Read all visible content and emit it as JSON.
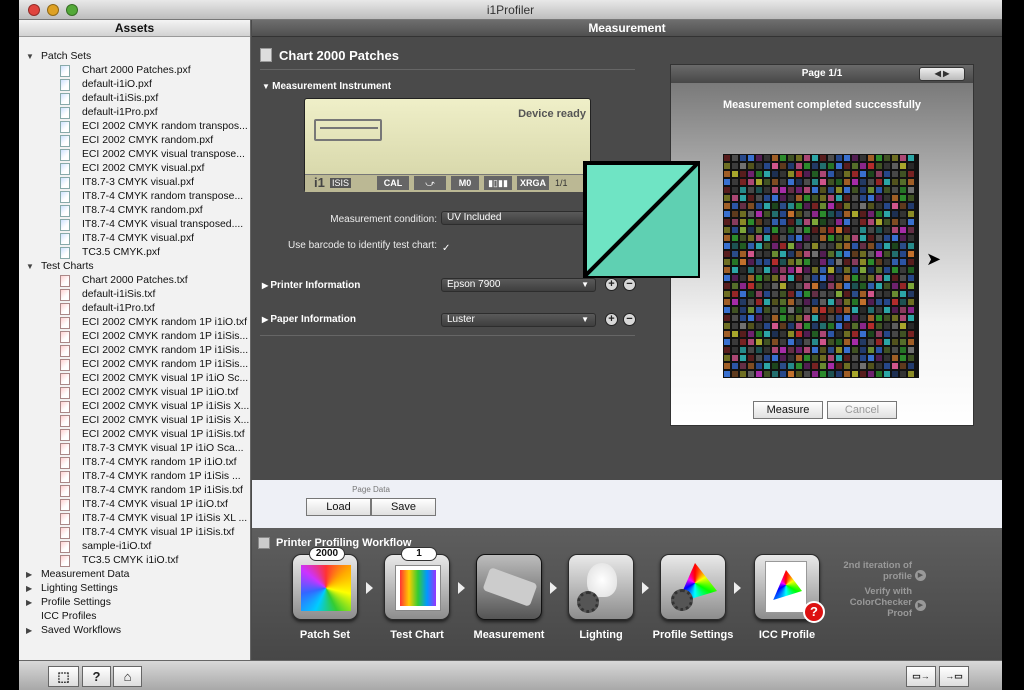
{
  "window": {
    "title": "i1Profiler"
  },
  "sidebar": {
    "title": "Assets",
    "patch_sets": {
      "label": "Patch Sets",
      "items": [
        "Chart 2000 Patches.pxf",
        "default-i1iO.pxf",
        "default-i1iSis.pxf",
        "default-i1Pro.pxf",
        "ECI 2002 CMYK random transpos...",
        "ECI 2002 CMYK random.pxf",
        "ECI 2002 CMYK visual transpose...",
        "ECI 2002 CMYK visual.pxf",
        "IT8.7-3 CMYK visual.pxf",
        "IT8.7-4 CMYK random transpose...",
        "IT8.7-4 CMYK random.pxf",
        "IT8.7-4 CMYK visual transposed....",
        "IT8.7-4 CMYK visual.pxf",
        "TC3.5 CMYK.pxf"
      ]
    },
    "test_charts": {
      "label": "Test Charts",
      "items": [
        "Chart 2000 Patches.txf",
        "default-i1iSis.txf",
        "default-i1Pro.txf",
        "ECI 2002 CMYK random 1P i1iO.txf",
        "ECI 2002 CMYK random 1P i1iSis...",
        "ECI 2002 CMYK random 1P i1iSis...",
        "ECI 2002 CMYK random 1P i1iSis...",
        "ECI 2002 CMYK visual 1P i1iO Sc...",
        "ECI 2002 CMYK visual 1P i1iO.txf",
        "ECI 2002 CMYK visual 1P i1iSis X...",
        "ECI 2002 CMYK visual 1P i1iSis X...",
        "ECI 2002 CMYK visual 1P i1iSis.txf",
        "IT8.7-3 CMYK visual 1P i1iO Sca...",
        "IT8.7-4 CMYK random 1P i1iO.txf",
        "IT8.7-4 CMYK random 1P i1iSis ...",
        "IT8.7-4 CMYK random 1P i1iSis.txf",
        "IT8.7-4 CMYK visual 1P i1iO.txf",
        "IT8.7-4 CMYK visual 1P i1iSis XL ...",
        "IT8.7-4 CMYK visual 1P i1iSis.txf",
        "sample-i1iO.txf",
        "TC3.5 CMYK i1iO.txf"
      ]
    },
    "collapsed": [
      "Measurement Data",
      "Lighting Settings",
      "Profile Settings",
      "ICC Profiles",
      "Saved Workflows"
    ]
  },
  "main": {
    "header": "Measurement",
    "chart_title": "Chart 2000 Patches",
    "instrument_section": "Measurement Instrument",
    "device_status": "Device ready",
    "device_buttons": [
      "CAL",
      "M0",
      "XRGA",
      "1/1"
    ],
    "device_brand": "i1",
    "device_model": "ISIS",
    "measurement_condition_label": "Measurement condition:",
    "measurement_condition_value": "UV Included",
    "barcode_label": "Use barcode to identify test chart:",
    "barcode_checked": "✓",
    "printer_info_label": "Printer Information",
    "printer_value": "Epson 7900",
    "paper_info_label": "Paper Information",
    "paper_value": "Luster"
  },
  "preview": {
    "page_label": "Page 1/1",
    "status": "Measurement completed successfully",
    "measure_button": "Measure",
    "cancel_button": "Cancel"
  },
  "page_data": {
    "label": "Page Data",
    "load": "Load",
    "save": "Save"
  },
  "workflow": {
    "title": "Printer Profiling Workflow",
    "steps": [
      {
        "label": "Patch Set",
        "badge": "2000"
      },
      {
        "label": "Test Chart",
        "badge": "1"
      },
      {
        "label": "Measurement",
        "badge": ""
      },
      {
        "label": "Lighting",
        "badge": ""
      },
      {
        "label": "Profile Settings",
        "badge": ""
      },
      {
        "label": "ICC Profile",
        "badge": ""
      }
    ],
    "second_iteration": "2nd iteration of profile",
    "verify": "Verify with ColorChecker Proof"
  },
  "colors": {
    "overlay_fill": "#6fe4c4",
    "overlay_fill_dark": "#5bc9a9"
  }
}
